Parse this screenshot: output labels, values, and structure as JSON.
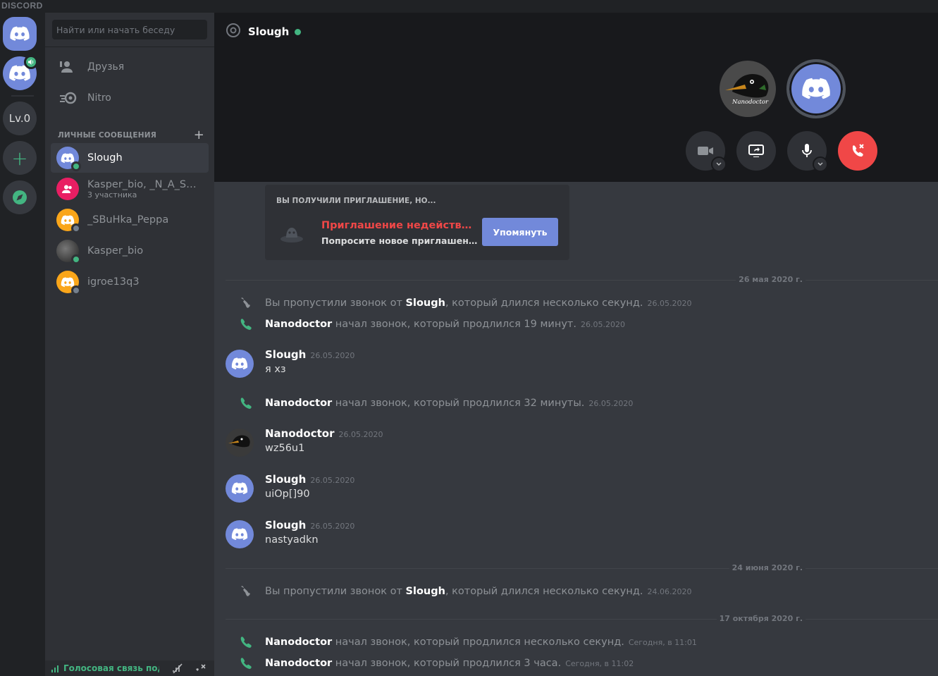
{
  "app": {
    "wordmark": "DISCORD"
  },
  "rail": {
    "level_label": "Lv.0",
    "add_label": "+"
  },
  "sidebar": {
    "search_placeholder": "Найти или начать беседу",
    "nav": [
      {
        "label": "Друзья"
      },
      {
        "label": "Nitro"
      }
    ],
    "dm_header": "ЛИЧНЫЕ СООБЩЕНИЯ",
    "dm_add": "+",
    "dms": [
      {
        "name": "Slough",
        "status": "online"
      },
      {
        "name": "Kasper_bio, _N_A_S_...",
        "sub": "3 участника"
      },
      {
        "name": "_SBuHka_Peppa",
        "status": "offline"
      },
      {
        "name": "Kasper_bio",
        "status": "online"
      },
      {
        "name": "igroe13q3",
        "status": "offline"
      }
    ],
    "voice_status": "Голосовая связь подключена"
  },
  "call": {
    "title": "Slough",
    "participant_caption": "Nanodoctor"
  },
  "invite": {
    "header": "ВЫ ПОЛУЧИЛИ ПРИГЛАШЕНИЕ, НО...",
    "error": "Приглашение недействительно",
    "sub": "Попросите новое приглашение у Slough",
    "button": "Упомянуть"
  },
  "messages": {
    "divider1": "26 мая 2020 г.",
    "divider2": "24 июня 2020 г.",
    "divider3": "17 октября 2020 г.",
    "missed_prefix": "Вы пропустили звонок от",
    "missed_suffix": ", который длился несколько секунд.",
    "sys1": {
      "who": "Slough",
      "ts": "26.05.2020"
    },
    "sys2": {
      "who": "Nanodoctor",
      "text": "начал звонок, который продлился 19 минут.",
      "ts": "26.05.2020"
    },
    "msg1": {
      "author": "Slough",
      "ts": "26.05.2020",
      "text": "я хз"
    },
    "sys3": {
      "who": "Nanodoctor",
      "text": "начал звонок, который продлился 32 минуты.",
      "ts": "26.05.2020"
    },
    "msg2": {
      "author": "Nanodoctor",
      "ts": "26.05.2020",
      "text": "wz56u1"
    },
    "msg3": {
      "author": "Slough",
      "ts": "26.05.2020",
      "text": "uiOp[]90"
    },
    "msg4": {
      "author": "Slough",
      "ts": "26.05.2020",
      "text": "nastyadkn"
    },
    "sys4": {
      "who": "Slough",
      "ts": "24.06.2020"
    },
    "sys5": {
      "who": "Nanodoctor",
      "text": "начал звонок, который продлился несколько секунд.",
      "ts": "Сегодня, в 11:01"
    },
    "sys6": {
      "who": "Nanodoctor",
      "text": "начал звонок, который продлился 3 часа.",
      "ts": "Сегодня, в 11:02"
    }
  },
  "colors": {
    "accent": "#7289da",
    "online": "#43b581",
    "danger": "#f04747",
    "idle": "#faa61a"
  }
}
